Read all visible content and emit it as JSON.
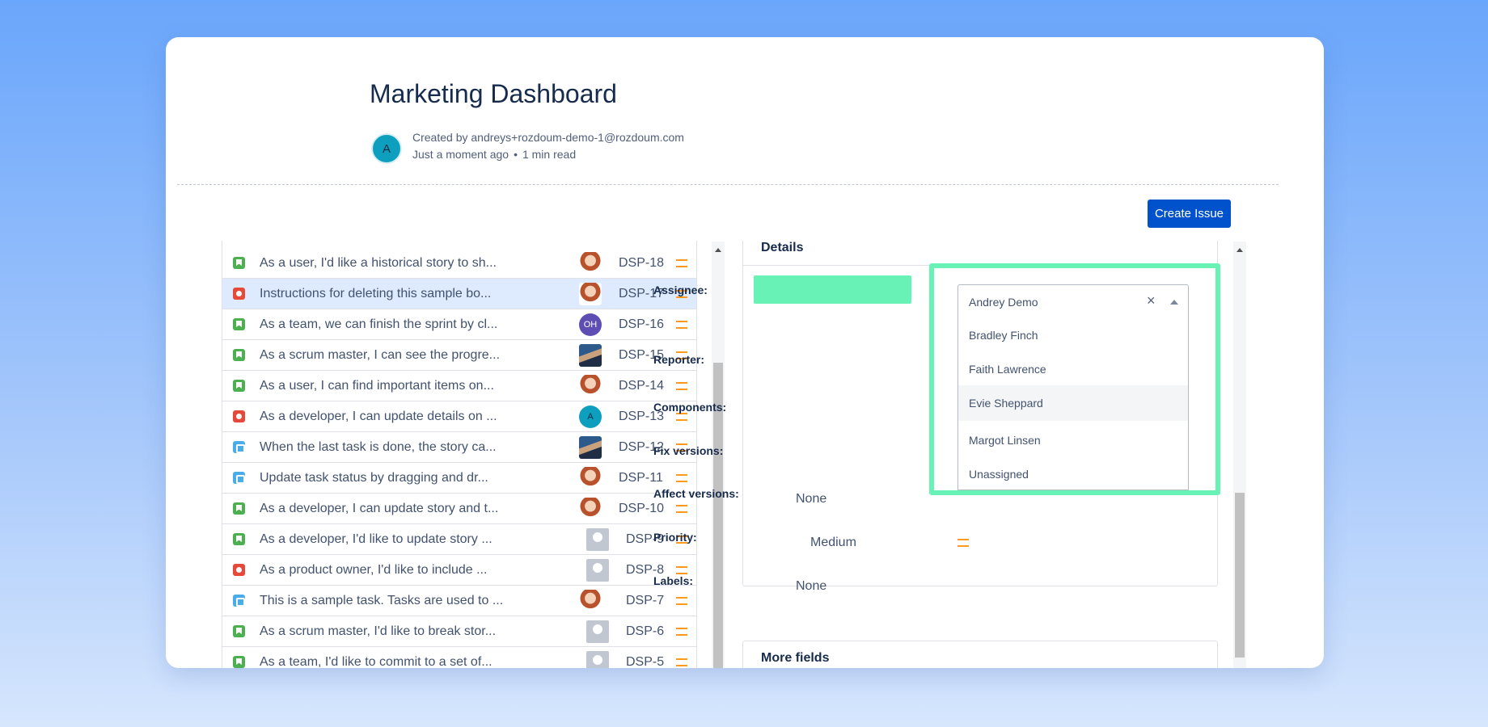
{
  "page": {
    "title": "Marketing Dashboard",
    "author_avatar": "A",
    "created_by": "Created by andreys+rozdoum-demo-1@rozdoum.com",
    "time": "Just a moment ago",
    "dot": "•",
    "read_time": "1 min read"
  },
  "toolbar": {
    "create_issue": "Create Issue"
  },
  "issues": [
    {
      "summary": "As a user, I'd like a historical story to sh...",
      "key": "DSP-18",
      "type": "story",
      "avatar": "photo-f",
      "avatar_text": ""
    },
    {
      "summary": "Instructions for deleting this sample bo...",
      "key": "DSP-17",
      "type": "bug",
      "avatar": "photo-f",
      "avatar_text": ""
    },
    {
      "summary": "As a team, we can finish the sprint by cl...",
      "key": "DSP-16",
      "type": "story",
      "avatar": "oh",
      "avatar_text": "OH"
    },
    {
      "summary": "As a scrum master, I can see the progre...",
      "key": "DSP-15",
      "type": "story",
      "avatar": "photo-m",
      "avatar_text": ""
    },
    {
      "summary": "As a user, I can find important items on...",
      "key": "DSP-14",
      "type": "story",
      "avatar": "photo-f",
      "avatar_text": ""
    },
    {
      "summary": "As a developer, I can update details on ...",
      "key": "DSP-13",
      "type": "bug",
      "avatar": "a",
      "avatar_text": "A"
    },
    {
      "summary": "When the last task is done, the story ca...",
      "key": "DSP-12",
      "type": "task",
      "avatar": "photo-m",
      "avatar_text": ""
    },
    {
      "summary": "Update task status by dragging and dr...",
      "key": "DSP-11",
      "type": "task",
      "avatar": "photo-f",
      "avatar_text": ""
    },
    {
      "summary": "As a developer, I can update story and t...",
      "key": "DSP-10",
      "type": "story",
      "avatar": "photo-f",
      "avatar_text": ""
    },
    {
      "summary": "As a developer, I'd like to update story ...",
      "key": "DSP-9",
      "type": "story",
      "avatar": "default",
      "avatar_text": ""
    },
    {
      "summary": "As a product owner, I'd like to include ...",
      "key": "DSP-8",
      "type": "bug",
      "avatar": "default",
      "avatar_text": ""
    },
    {
      "summary": "This is a sample task. Tasks are used to ...",
      "key": "DSP-7",
      "type": "task",
      "avatar": "photo-f",
      "avatar_text": ""
    },
    {
      "summary": "As a scrum master, I'd like to break stor...",
      "key": "DSP-6",
      "type": "story",
      "avatar": "default",
      "avatar_text": ""
    },
    {
      "summary": "As a team, I'd like to commit to a set of...",
      "key": "DSP-5",
      "type": "story",
      "avatar": "default",
      "avatar_text": ""
    }
  ],
  "selected_issue": "DSP-17",
  "details": {
    "title": "Details",
    "assignee_label": "Assignee:",
    "reporter_label": "Reporter:",
    "components_label": "Components:",
    "fix_versions_label": "Fix versions:",
    "affect_versions_label": "Affect versions:",
    "affect_versions_value": "None",
    "priority_label": "Priority:",
    "priority_value": "Medium",
    "labels_label": "Labels:",
    "labels_value": "None"
  },
  "assignee_dropdown": {
    "selected": "Andrey Demo",
    "clear_icon": "×",
    "options": [
      "Bradley Finch",
      "Faith Lawrence",
      "Evie Sheppard",
      "Margot Linsen",
      "Unassigned"
    ],
    "hovered": "Evie Sheppard"
  },
  "more_fields": {
    "title": "More fields"
  },
  "colors": {
    "accent": "#0052cc",
    "highlight": "#68f2b6",
    "priority_medium": "#ff991f"
  }
}
